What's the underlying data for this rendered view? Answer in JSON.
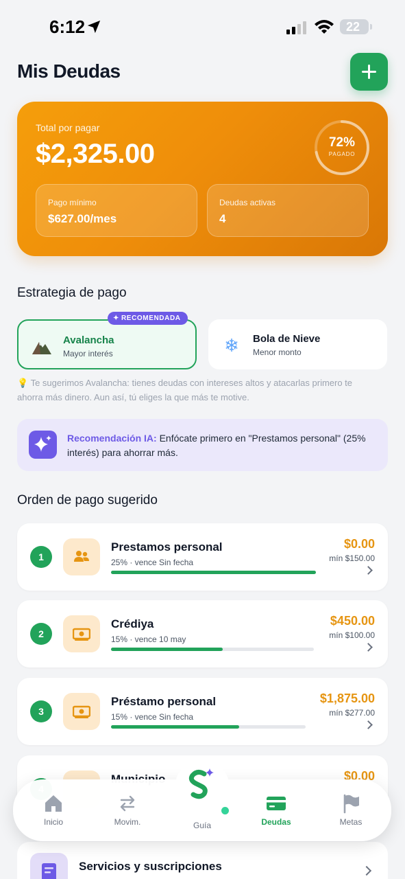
{
  "status_bar": {
    "time": "6:12",
    "battery": "22"
  },
  "header": {
    "title": "Mis Deudas"
  },
  "summary": {
    "total_label": "Total por pagar",
    "total_amount": "$2,325.00",
    "paid_percent": "72%",
    "paid_progress": 0.72,
    "paid_label": "PAGADO",
    "min_payment_label": "Pago mínimo",
    "min_payment_value": "$627.00/mes",
    "active_debts_label": "Deudas activas",
    "active_debts_value": "4"
  },
  "strategy": {
    "title": "Estrategia de pago",
    "badge": "RECOMENDADA",
    "options": [
      {
        "name": "Avalancha",
        "subtitle": "Mayor interés",
        "icon": "mountain-icon",
        "selected": true
      },
      {
        "name": "Bola de Nieve",
        "subtitle": "Menor monto",
        "icon": "snowflake-icon",
        "selected": false
      }
    ],
    "hint": "💡 Te sugerimos Avalancha: tienes deudas con intereses altos y atacarlas primero te ahorra más dinero. Aun así, tú eliges la que más te motive."
  },
  "ai_recommendation": {
    "label": "Recomendación IA:",
    "text": " Enfócate primero en \"Prestamos personal\" (25% interés) para ahorrar más."
  },
  "order": {
    "title": "Orden de pago sugerido",
    "debts": [
      {
        "rank": "1",
        "name": "Prestamos personal",
        "meta": "25% · vence Sin fecha",
        "amount": "$0.00",
        "min": "mín $150.00",
        "progress": 1.0,
        "icon": "people-icon"
      },
      {
        "rank": "2",
        "name": "Crédiya",
        "meta": "15% · vence 10 may",
        "amount": "$450.00",
        "min": "mín $100.00",
        "progress": 0.55,
        "icon": "money-icon"
      },
      {
        "rank": "3",
        "name": "Préstamo personal",
        "meta": "15% · vence Sin fecha",
        "amount": "$1,875.00",
        "min": "mín $277.00",
        "progress": 0.66,
        "icon": "money-icon"
      },
      {
        "rank": "4",
        "name": "Municipio",
        "meta": "",
        "amount": "$0.00",
        "min": "",
        "progress": 1.0,
        "icon": "money-icon"
      }
    ]
  },
  "nav": {
    "items": [
      {
        "label": "Inicio",
        "icon": "home-icon"
      },
      {
        "label": "Movim.",
        "icon": "transfer-icon"
      },
      {
        "label": "Guía",
        "icon": "guide-logo-icon"
      },
      {
        "label": "Deudas",
        "icon": "card-icon",
        "active": true
      },
      {
        "label": "Metas",
        "icon": "flag-icon"
      }
    ]
  },
  "services": {
    "title": "Servicios y suscripciones"
  },
  "colors": {
    "primary": "#22a35a",
    "accent": "#f59e0b",
    "ai": "#6d5ae6"
  }
}
